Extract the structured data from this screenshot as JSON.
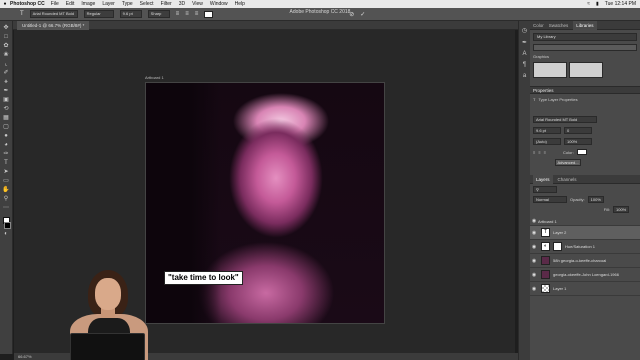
{
  "menubar": {
    "app_name": "Photoshop CC",
    "items": [
      "File",
      "Edit",
      "Image",
      "Layer",
      "Type",
      "Select",
      "Filter",
      "3D",
      "View",
      "Window",
      "Help"
    ],
    "clock": "Tue 12:14 PM"
  },
  "options_bar": {
    "window_title": "Adobe Photoshop CC 2018",
    "font_family": "Arial Rounded MT Bold",
    "font_style": "Regular",
    "font_size": "9.6 pt",
    "antialias": "Sharp"
  },
  "document": {
    "tab_title": "Untitled-1 @ 66.7% (RGB/8#) *",
    "artboard_label": "Artboard 1",
    "caption": "\"take time to look\"",
    "zoom": "66.67%"
  },
  "libraries_panel": {
    "tabs": [
      "Color",
      "Swatches",
      "Libraries"
    ],
    "active_tab": "Libraries",
    "library": "My Library",
    "section": "Graphics"
  },
  "properties_panel": {
    "title": "Properties",
    "subtitle": "Type Layer Properties",
    "font": "Arial Rounded MT Bold",
    "size": "9.6 pt",
    "leading": "(Auto)",
    "tracking": "0",
    "scale": "100%",
    "color_label": "Color:",
    "advanced_label": "Advanced..."
  },
  "layers_panel": {
    "tabs": [
      "Layers",
      "Channels"
    ],
    "blend_mode": "Normal",
    "opacity_label": "Opacity:",
    "opacity": "100%",
    "fill_label": "Fill:",
    "fill": "100%",
    "layers": [
      {
        "name": "Artboard 1",
        "type": "group"
      },
      {
        "name": "Layer 2",
        "type": "text",
        "selected": true
      },
      {
        "name": "Hue/Saturation 1",
        "type": "adjustment"
      },
      {
        "name": "58h georgia-o-keeffe-charcoal",
        "type": "image"
      },
      {
        "name": "georgia-okeeffe-John Loengard-1966",
        "type": "image"
      },
      {
        "name": "Layer 1",
        "type": "pixel"
      }
    ]
  },
  "colors": {
    "workspace": "#282828",
    "panel": "#4a4a4a",
    "accent_magenta": "#c45a98"
  },
  "icons": [
    "apple-icon",
    "wifi-icon",
    "battery-icon",
    "move-icon",
    "marquee-icon",
    "lasso-icon",
    "crop-icon",
    "eyedropper-icon",
    "brush-icon",
    "type-icon",
    "hand-icon",
    "zoom-icon",
    "eye-icon"
  ]
}
